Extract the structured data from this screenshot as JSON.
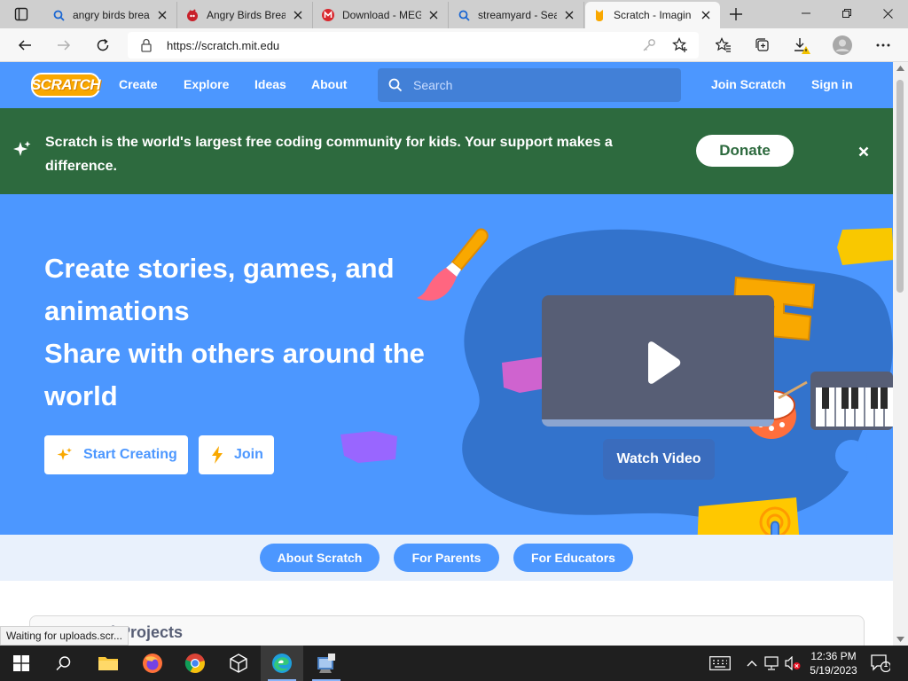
{
  "browser": {
    "tabs": [
      {
        "title": "angry birds brea",
        "icon": "search-icon"
      },
      {
        "title": "Angry Birds Brea",
        "icon": "angry-bird-icon"
      },
      {
        "title": "Download - MEG",
        "icon": "mega-icon"
      },
      {
        "title": "streamyard - Sea",
        "icon": "search-icon"
      },
      {
        "title": "Scratch - Imagin",
        "icon": "scratch-cat-icon",
        "active": true
      }
    ],
    "url": "https://scratch.mit.edu",
    "status": "Waiting for uploads.scr..."
  },
  "scratch_nav": {
    "logo": "SCRATCH",
    "links": [
      "Create",
      "Explore",
      "Ideas",
      "About"
    ],
    "search_placeholder": "Search",
    "join": "Join Scratch",
    "signin": "Sign in"
  },
  "banner": {
    "message": "Scratch is the world's largest free coding community for kids. Your support makes a difference.",
    "donate": "Donate"
  },
  "hero": {
    "line1": "Create stories, games, and animations",
    "line2": "Share with others around the world",
    "start_creating": "Start Creating",
    "join": "Join",
    "watch_video": "Watch Video"
  },
  "subnav": {
    "about_scratch": "About Scratch",
    "for_parents": "For Parents",
    "for_educators": "For Educators"
  },
  "featured": {
    "title": "Featured Projects"
  },
  "taskbar": {
    "time": "12:36 PM",
    "date": "5/19/2023",
    "notifications": "1"
  },
  "colors": {
    "scratch_blue": "#4c97ff",
    "banner_green": "#2d6a3e",
    "logo_orange": "#f9a800"
  }
}
